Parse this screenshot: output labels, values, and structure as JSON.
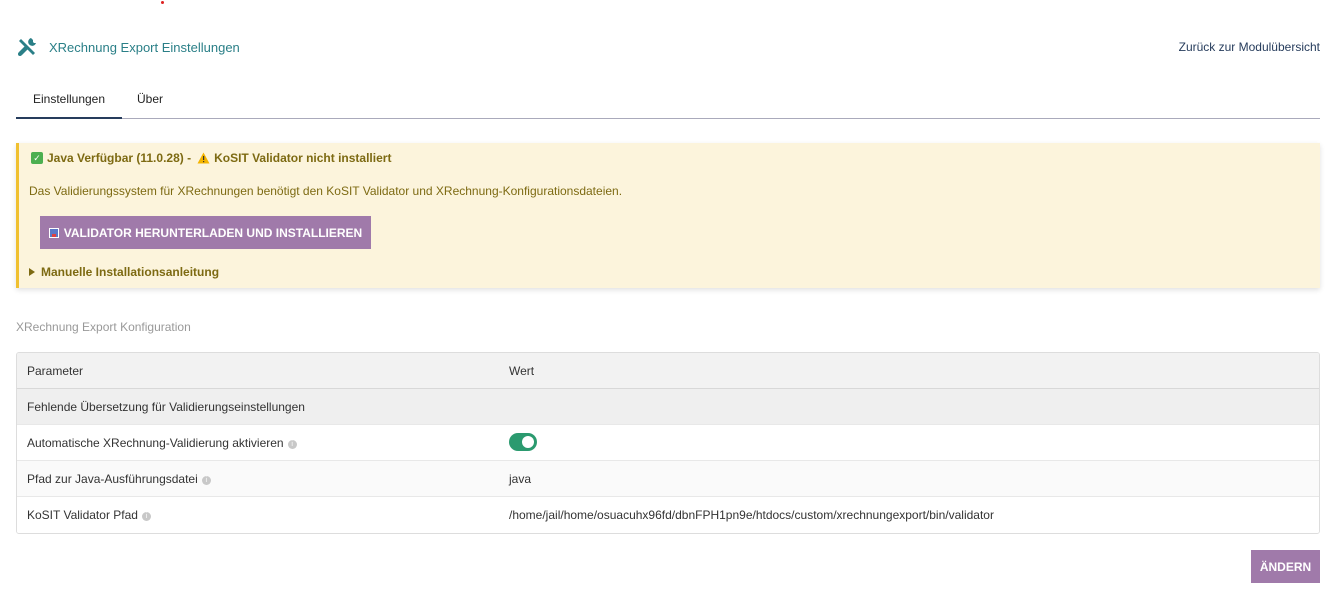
{
  "header": {
    "title": "XRechnung Export Einstellungen",
    "back_link": "Zurück zur Modulübersicht"
  },
  "tabs": [
    {
      "label": "Einstellungen",
      "active": true
    },
    {
      "label": "Über",
      "active": false
    }
  ],
  "alert": {
    "java_status": "Java Verfügbar (11.0.28) -",
    "validator_status": "KoSIT Validator nicht installiert",
    "description": "Das Validierungssystem für XRechnungen benötigt den KoSIT Validator und XRechnung-Konfigurationsdateien.",
    "install_button": "VALIDATOR HERUNTERLADEN UND INSTALLIEREN",
    "manual_toggle": "Manuelle Installationsanleitung"
  },
  "config": {
    "section_title": "XRechnung Export Konfiguration",
    "columns": [
      "Parameter",
      "Wert"
    ],
    "subheader": "Fehlende Übersetzung für Validierungseinstellungen",
    "rows": [
      {
        "parameter": "Automatische XRechnung-Validierung aktivieren",
        "value": "",
        "toggle_on": true
      },
      {
        "parameter": "Pfad zur Java-Ausführungsdatei",
        "value": "java"
      },
      {
        "parameter": "KoSIT Validator Pfad",
        "value": "/home/jail/home/osuacuhx96fd/dbnFPH1pn9e/htdocs/custom/xrechnungexport/bin/validator"
      }
    ]
  },
  "actions": {
    "change_button": "ÄNDERN"
  },
  "colors": {
    "accent": "#a07aaa",
    "title": "#2a7f87",
    "alert_bg": "#fcf4dc",
    "alert_text": "#7d6a12",
    "toggle_on": "#2b9a6f"
  }
}
